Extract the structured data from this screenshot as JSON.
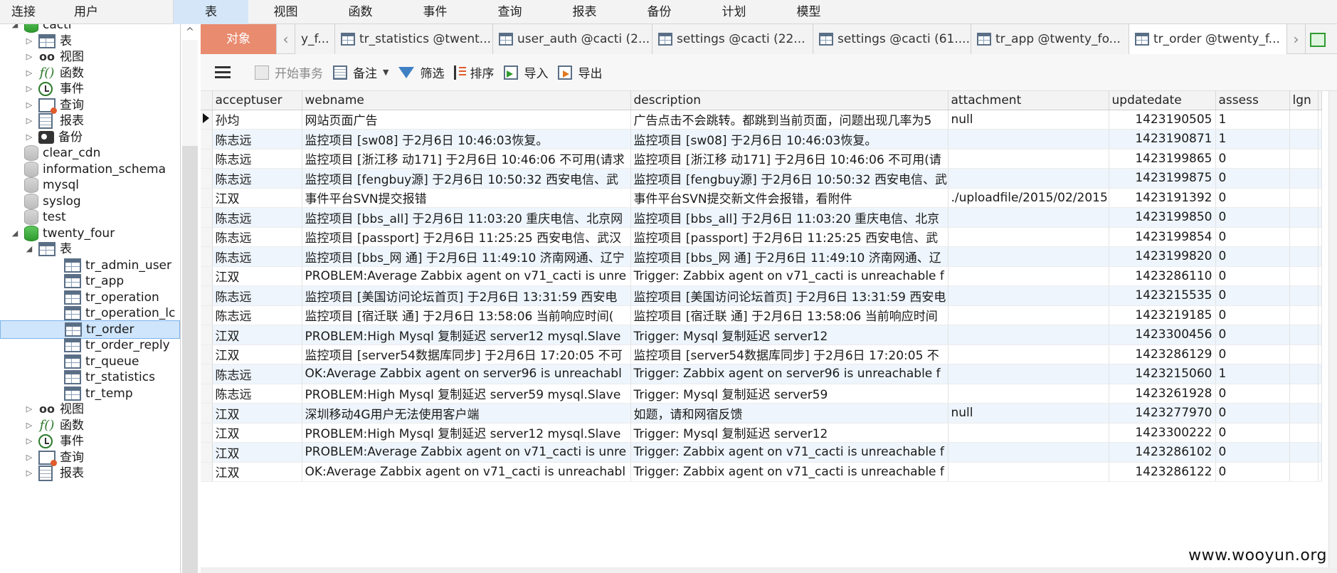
{
  "menubar": {
    "left": [
      "连接",
      "用户"
    ],
    "main": [
      "表",
      "视图",
      "函数",
      "事件",
      "查询",
      "报表",
      "备份",
      "计划",
      "模型"
    ],
    "active": "表"
  },
  "sidebar": {
    "cacti_label": "cacti",
    "cacti_children": [
      "表",
      "视图",
      "函数",
      "事件",
      "查询",
      "报表",
      "备份"
    ],
    "databases": [
      "clear_cdn",
      "information_schema",
      "mysql",
      "syslog",
      "test"
    ],
    "twenty_four": {
      "label": "twenty_four",
      "tables_label": "表",
      "tables": [
        "tr_admin_user",
        "tr_app",
        "tr_operation",
        "tr_operation_lc",
        "tr_order",
        "tr_order_reply",
        "tr_queue",
        "tr_statistics",
        "tr_temp"
      ],
      "selected": "tr_order",
      "after": [
        "视图",
        "函数",
        "事件",
        "查询",
        "报表"
      ]
    },
    "scroll_up": "^"
  },
  "tabs": {
    "objects": "对象",
    "items": [
      "y_f...",
      "tr_statistics @twent...",
      "user_auth @cacti (2...",
      "settings @cacti (22...",
      "settings @cacti (61....",
      "tr_app @twenty_fo...",
      "tr_order @twenty_f..."
    ],
    "active_index": 6,
    "nav_left": "‹",
    "nav_right": "›"
  },
  "toolbar": {
    "begin_tx": "开始事务",
    "note": "备注",
    "filter": "筛选",
    "sort": "排序",
    "import": "导入",
    "export": "导出"
  },
  "grid": {
    "columns": [
      "acceptuser",
      "webname",
      "description",
      "attachment",
      "updatedate",
      "assess",
      "lgn"
    ],
    "rows": [
      [
        "孙均",
        "网站页面广告",
        "广告点击不会跳转。都跳到当前页面，问题出现几率为5",
        "null",
        "1423190505",
        "1"
      ],
      [
        "陈志远",
        "监控项目 [sw08] 于2月6日 10:46:03恢复。",
        "监控项目 [sw08] 于2月6日 10:46:03恢复。",
        "",
        "1423190871",
        "1"
      ],
      [
        "陈志远",
        "监控项目 [浙江移 动171] 于2月6日 10:46:06 不可用(请求",
        "监控项目 [浙江移 动171] 于2月6日 10:46:06 不可用(请",
        "",
        "1423199865",
        "0"
      ],
      [
        "陈志远",
        "监控项目 [fengbuy源] 于2月6日 10:50:32 西安电信、武",
        "监控项目 [fengbuy源] 于2月6日 10:50:32 西安电信、武",
        "",
        "1423199875",
        "0"
      ],
      [
        "江双",
        "事件平台SVN提交报错",
        "事件平台SVN提交新文件会报错，看附件",
        "./uploadfile/2015/02/2015",
        "1423191392",
        "0"
      ],
      [
        "陈志远",
        "监控项目 [bbs_all] 于2月6日 11:03:20 重庆电信、北京网",
        "监控项目 [bbs_all] 于2月6日 11:03:20 重庆电信、北京",
        "",
        "1423199850",
        "0"
      ],
      [
        "陈志远",
        "监控项目 [passport] 于2月6日 11:25:25 西安电信、武汉",
        "监控项目 [passport] 于2月6日 11:25:25 西安电信、武",
        "",
        "1423199854",
        "0"
      ],
      [
        "陈志远",
        "监控项目 [bbs_网 通] 于2月6日 11:49:10 济南网通、辽宁",
        "监控项目 [bbs_网 通] 于2月6日 11:49:10 济南网通、辽",
        "",
        "1423199820",
        "0"
      ],
      [
        "江双",
        "PROBLEM:Average Zabbix agent on v71_cacti is unre",
        "Trigger: Zabbix agent on v71_cacti is unreachable f",
        "",
        "1423286110",
        "0"
      ],
      [
        "陈志远",
        "监控项目 [美国访问论坛首页] 于2月6日 13:31:59 西安电",
        "监控项目 [美国访问论坛首页] 于2月6日 13:31:59 西安电",
        "",
        "1423215535",
        "0"
      ],
      [
        "陈志远",
        "监控项目 [宿迁联 通] 于2月6日 13:58:06 当前响应时间(",
        "监控项目 [宿迁联 通] 于2月6日 13:58:06 当前响应时间",
        "",
        "1423219185",
        "0"
      ],
      [
        "江双",
        "PROBLEM:High Mysql 复制延迟  server12 mysql.Slave",
        "Trigger: Mysql 复制延迟  server12",
        "",
        "1423300456",
        "0"
      ],
      [
        "江双",
        "监控项目 [server54数据库同步] 于2月6日 17:20:05 不可",
        "监控项目 [server54数据库同步] 于2月6日 17:20:05 不",
        "",
        "1423286129",
        "0"
      ],
      [
        "陈志远",
        "OK:Average Zabbix agent on server96 is unreachabl",
        "Trigger: Zabbix agent on server96 is unreachable f",
        "",
        "1423215060",
        "1"
      ],
      [
        "陈志远",
        "PROBLEM:High Mysql 复制延迟  server59 mysql.Slave",
        "Trigger: Mysql 复制延迟  server59",
        "",
        "1423261928",
        "0"
      ],
      [
        "江双",
        "深圳移动4G用户无法使用客户端",
        "如题，请和网宿反馈",
        "null",
        "1423277970",
        "0"
      ],
      [
        "江双",
        "PROBLEM:High Mysql 复制延迟  server12 mysql.Slave",
        "Trigger: Mysql 复制延迟  server12",
        "",
        "1423300222",
        "0"
      ],
      [
        "江双",
        "PROBLEM:Average Zabbix agent on v71_cacti is unre",
        "Trigger: Zabbix agent on v71_cacti is unreachable f",
        "",
        "1423286102",
        "0"
      ],
      [
        "江双",
        "OK:Average Zabbix agent on v71_cacti is unreachabl",
        "Trigger: Zabbix agent on v71_cacti is unreachable f",
        "",
        "1423286122",
        "0"
      ]
    ],
    "current_row": 0
  },
  "watermark": "www.wooyun.org"
}
